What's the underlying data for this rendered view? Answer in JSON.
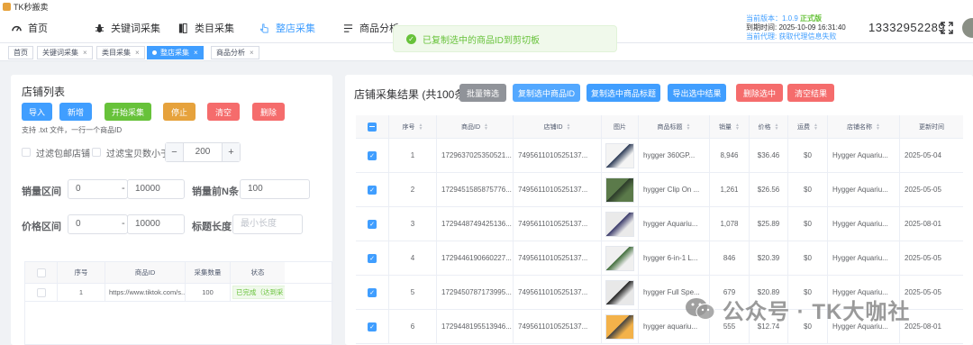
{
  "app": {
    "title": "TK秒搬卖"
  },
  "nav": [
    {
      "label": "首页",
      "icon": "dashboard-icon"
    },
    {
      "label": "关键词采集",
      "icon": "bug-icon"
    },
    {
      "label": "类目采集",
      "icon": "book-icon"
    },
    {
      "label": "整店采集",
      "icon": "cursor-icon",
      "active": true
    },
    {
      "label": "商品分析",
      "icon": "list-icon"
    }
  ],
  "header": {
    "version_prefix": "当前版本：1.0.9",
    "version_status": "正式版",
    "expire": "到期时间: 2025-10-09 16:31:40",
    "agent": "当前代理: 获取代理信息失败",
    "phone": "13332952289"
  },
  "toast": {
    "message": "已复制选中的商品ID到剪切板"
  },
  "tags": [
    {
      "label": "首页",
      "closable": false
    },
    {
      "label": "关键词采集",
      "closable": true
    },
    {
      "label": "类目采集",
      "closable": true
    },
    {
      "label": "整店采集",
      "closable": true,
      "active": true
    },
    {
      "label": "商品分析",
      "closable": true
    }
  ],
  "left": {
    "title": "店铺列表",
    "buttons": [
      "导入",
      "新增",
      "开始采集",
      "停止",
      "清空",
      "删除"
    ],
    "hint": "支持 .txt 文件，一行一个商品ID",
    "filter_free_shipping": "过滤包邮店铺",
    "filter_items": "过滤宝贝数小于",
    "filter_items_value": "200",
    "stepper_minus": "−",
    "stepper_plus": "+",
    "range_dash": "-",
    "sales_label": "销量区间",
    "sales_min": "0",
    "sales_max": "10000",
    "sales_top_label": "销量前N条",
    "sales_top_value": "100",
    "price_label": "价格区间",
    "price_min": "0",
    "price_max": "10000",
    "title_len_label": "标题长度",
    "title_len_placeholder": "最小长度",
    "table": {
      "headers": [
        "序号",
        "商品ID",
        "采集数量",
        "状态"
      ],
      "rows": [
        {
          "no": "1",
          "url": "https://www.tiktok.com/s...",
          "count": "100",
          "status": "已完成（达到采"
        }
      ]
    }
  },
  "right": {
    "title": "店铺采集结果 (共100条)",
    "buttons": [
      "批量筛选",
      "复制选中商品ID",
      "复制选中商品标题",
      "导出选中结果",
      "删除选中",
      "清空结果"
    ],
    "headers": [
      "序号",
      "商品ID",
      "店铺ID",
      "图片",
      "商品标题",
      "销量",
      "价格",
      "运费",
      "店铺名称",
      "更新时间"
    ],
    "rows": [
      {
        "no": "1",
        "pid": "1729637025350521...",
        "sid": "7495611010525137...",
        "title": "hygger 360GP...",
        "sales": "8,946",
        "price": "$36.46",
        "ship": "$0",
        "shop": "Hygger Aquariu...",
        "time": "2025-05-04"
      },
      {
        "no": "2",
        "pid": "1729451585875776...",
        "sid": "7495611010525137...",
        "title": "hygger Clip On ...",
        "sales": "1,261",
        "price": "$26.56",
        "ship": "$0",
        "shop": "Hygger Aquariu...",
        "time": "2025-05-05"
      },
      {
        "no": "3",
        "pid": "1729448749425136...",
        "sid": "7495611010525137...",
        "title": "hygger Aquariu...",
        "sales": "1,078",
        "price": "$25.89",
        "ship": "$0",
        "shop": "Hygger Aquariu...",
        "time": "2025-08-01"
      },
      {
        "no": "4",
        "pid": "1729446190660227...",
        "sid": "7495611010525137...",
        "title": "hygger 6-in-1 L...",
        "sales": "846",
        "price": "$20.39",
        "ship": "$0",
        "shop": "Hygger Aquariu...",
        "time": "2025-05-05"
      },
      {
        "no": "5",
        "pid": "1729450787173995...",
        "sid": "7495611010525137...",
        "title": "hygger Full Spe...",
        "sales": "679",
        "price": "$20.89",
        "ship": "$0",
        "shop": "Hygger Aquariu...",
        "time": "2025-05-05"
      },
      {
        "no": "6",
        "pid": "1729448195513946...",
        "sid": "7495611010525137...",
        "title": "hygger aquariu...",
        "sales": "555",
        "price": "$12.74",
        "ship": "$0",
        "shop": "Hygger Aquariu...",
        "time": "2025-08-01"
      }
    ]
  },
  "watermark": {
    "text": "公众号 · TK大咖社"
  },
  "colors": {
    "primary": "#409eff",
    "success": "#67c23a",
    "warning": "#e6a23c",
    "danger": "#f56c6c",
    "info": "#909399"
  }
}
